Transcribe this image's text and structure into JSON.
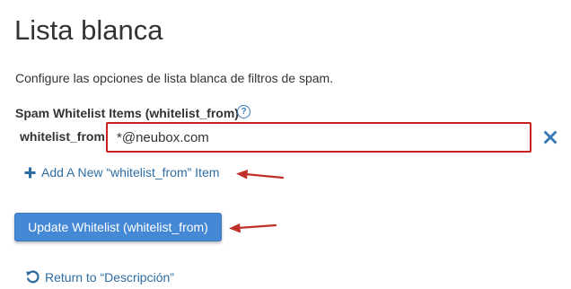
{
  "page": {
    "title": "Lista blanca",
    "description": "Configure las opciones de lista blanca de filtros de spam."
  },
  "section": {
    "label": "Spam Whitelist Items (whitelist_from)",
    "help_icon": "?"
  },
  "field": {
    "label": "whitelist_from",
    "value": "*@neubox.com",
    "remove_icon": "close-x",
    "highlight_color": "#c8201f"
  },
  "actions": {
    "add_icon": "plus",
    "add_label": "Add A New “whitelist_from” Item",
    "update_label": "Update Whitelist (whitelist_from)",
    "return_icon": "undo-arrow",
    "return_label": "Return to “Descripción”"
  },
  "colors": {
    "link": "#2e6da4",
    "button": "#4488d6",
    "annotation_arrow": "#c0302a"
  }
}
